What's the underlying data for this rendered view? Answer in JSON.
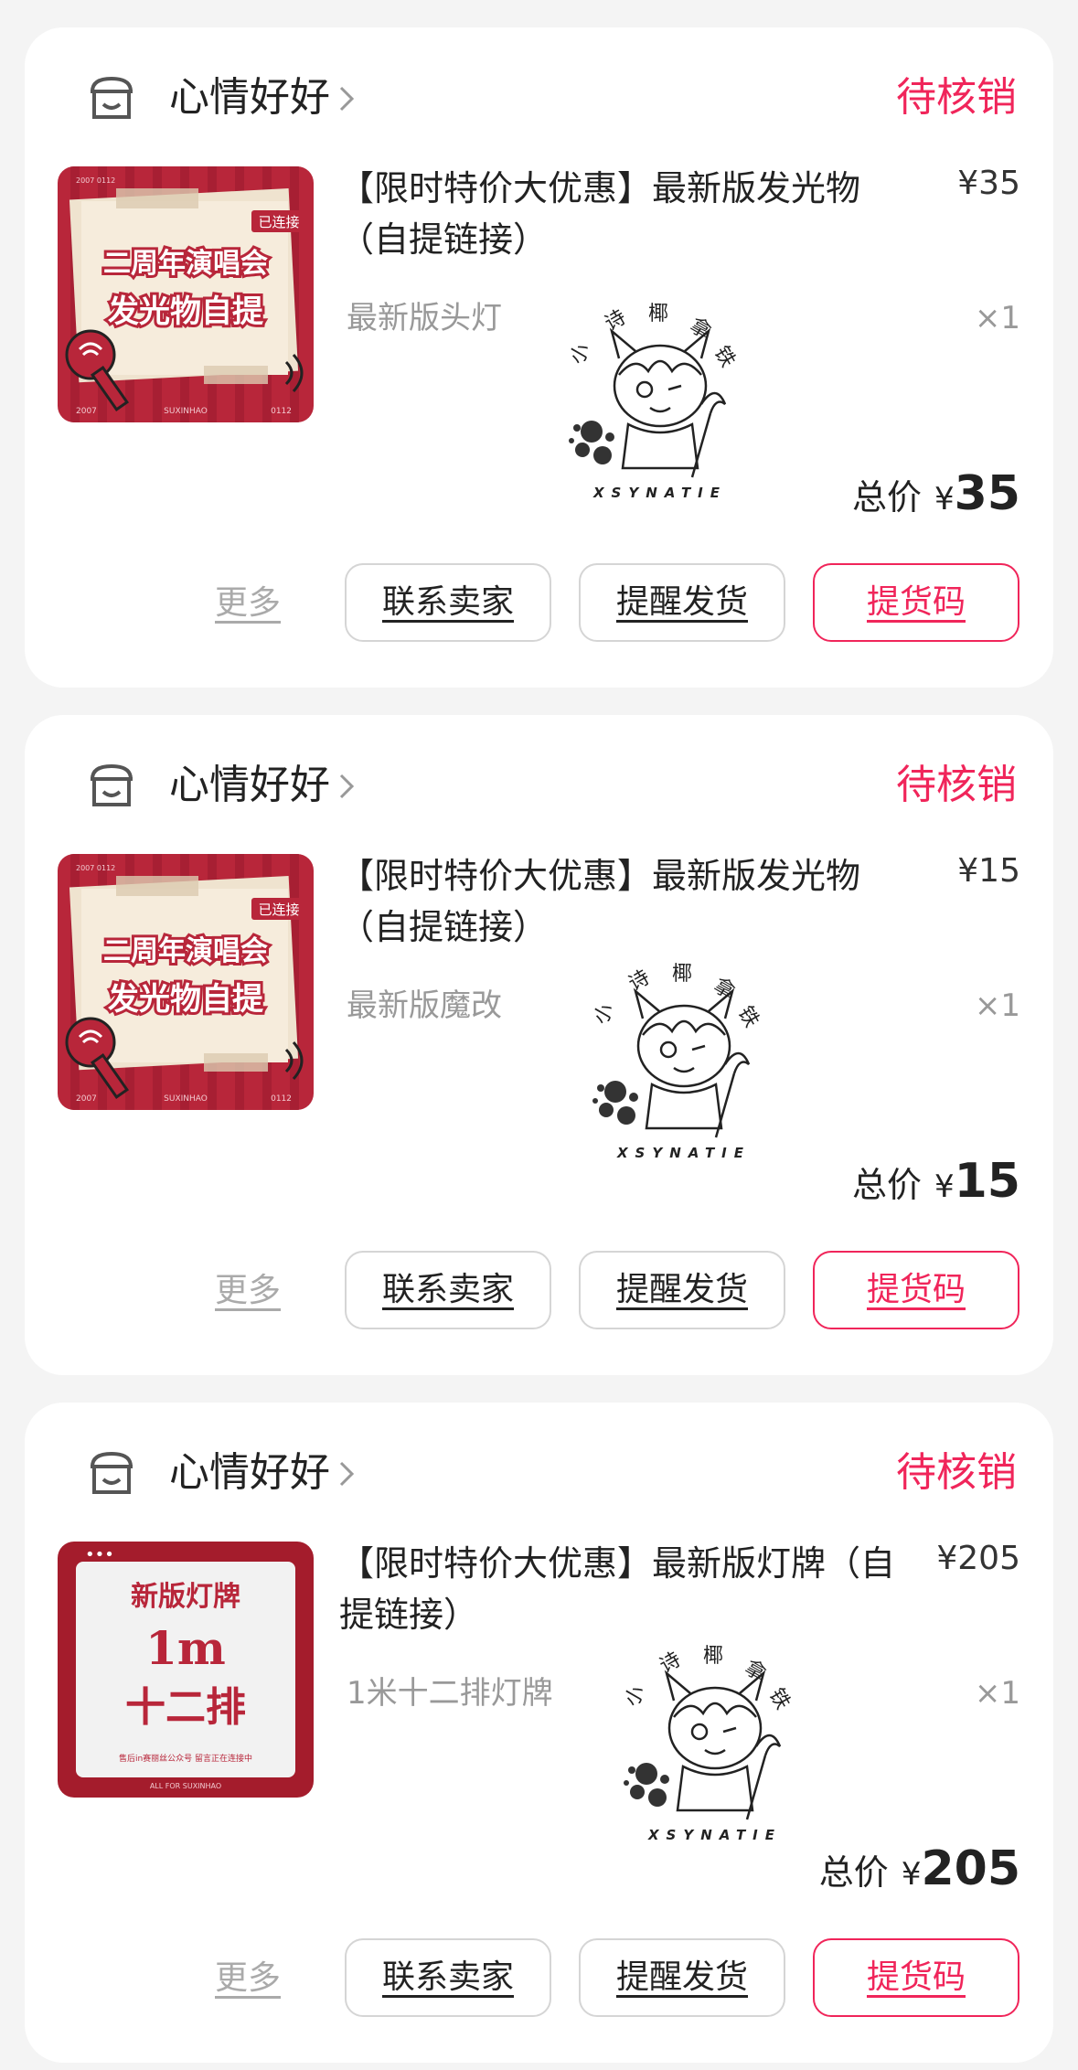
{
  "orders": [
    {
      "shop_name": "心情好好",
      "status": "待核销",
      "thumb": {
        "tag": "已连接",
        "line1": "二周年演唱会",
        "line2": "发光物自提",
        "corner_tl": "2007\n0112",
        "footer_left": "2007",
        "footer_mid": "SUXINHAO",
        "footer_right": "0112"
      },
      "title": "【限时特价大优惠】最新版发光物（自提链接）",
      "price": "¥35",
      "variant": "最新版头灯",
      "qty": "×1",
      "total_label": "总价",
      "total_symbol": "¥",
      "total_value": "35",
      "sticker": {
        "chars": [
          "小",
          "诗",
          "椰",
          "拿",
          "铁"
        ],
        "caption": "XSYNATIE"
      },
      "buttons": {
        "more": "更多",
        "contact": "联系卖家",
        "remind": "提醒发货",
        "code": "提货码"
      }
    },
    {
      "shop_name": "心情好好",
      "status": "待核销",
      "thumb": {
        "tag": "已连接",
        "line1": "二周年演唱会",
        "line2": "发光物自提",
        "corner_tl": "2007\n0112",
        "footer_left": "2007",
        "footer_mid": "SUXINHAO",
        "footer_right": "0112"
      },
      "title": "【限时特价大优惠】最新版发光物（自提链接）",
      "price": "¥15",
      "variant": "最新版魔改",
      "qty": "×1",
      "total_label": "总价",
      "total_symbol": "¥",
      "total_value": "15",
      "sticker": {
        "chars": [
          "小",
          "诗",
          "椰",
          "拿",
          "铁"
        ],
        "caption": "XSYNATIE"
      },
      "buttons": {
        "more": "更多",
        "contact": "联系卖家",
        "remind": "提醒发货",
        "code": "提货码"
      }
    },
    {
      "shop_name": "心情好好",
      "status": "待核销",
      "thumb": {
        "line1": "新版灯牌",
        "line2": "1m",
        "line3": "十二排",
        "small": "售后in赛丽丝公众号 留言正在连接中",
        "footer": "ALL FOR SUXINHAO",
        "dots": "•••"
      },
      "title": "【限时特价大优惠】最新版灯牌（自提链接）",
      "price": "¥205",
      "variant": "1米十二排灯牌",
      "qty": "×1",
      "total_label": "总价",
      "total_symbol": "¥",
      "total_value": "205",
      "sticker": {
        "chars": [
          "小",
          "诗",
          "椰",
          "拿",
          "铁"
        ],
        "caption": "XSYNATIE"
      },
      "buttons": {
        "more": "更多",
        "contact": "联系卖家",
        "remind": "提醒发货",
        "code": "提货码"
      }
    }
  ],
  "colors": {
    "accent": "#f0255a",
    "thumb_red": "#b8263a",
    "card_bg": "#ffffff",
    "page_bg": "#f4f4f4"
  }
}
